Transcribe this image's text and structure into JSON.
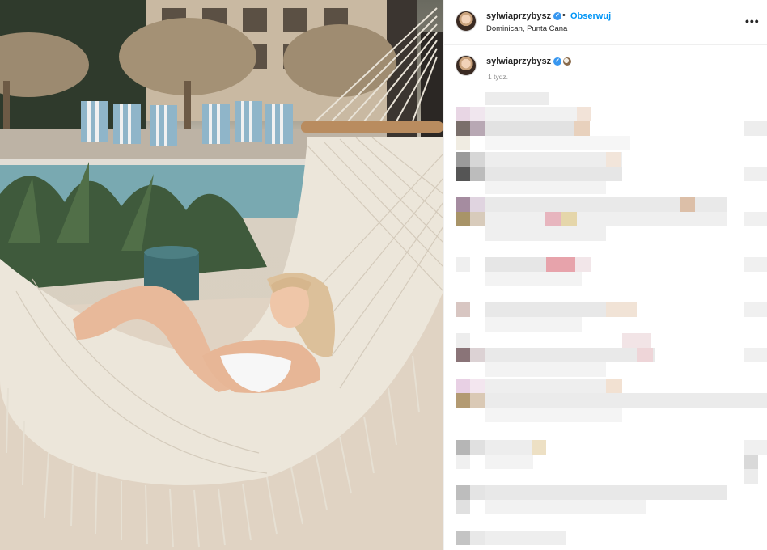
{
  "post": {
    "header": {
      "username": "sylwiaprzybysz",
      "separator": "•",
      "follow_label": "Obserwuj",
      "location": "Dominican, Punta Cana",
      "more_icon": "more-options-icon",
      "more_glyph": "•••"
    },
    "caption": {
      "username": "sylwiaprzybysz",
      "emoji_icon": "coconut-icon",
      "time": "1 tydz."
    },
    "photo": {
      "subject": "hammock-beach-photo"
    },
    "colors": {
      "accent": "#0095f6",
      "verified": "#3897f0",
      "text": "#262626",
      "muted": "#8e8e8e"
    }
  }
}
